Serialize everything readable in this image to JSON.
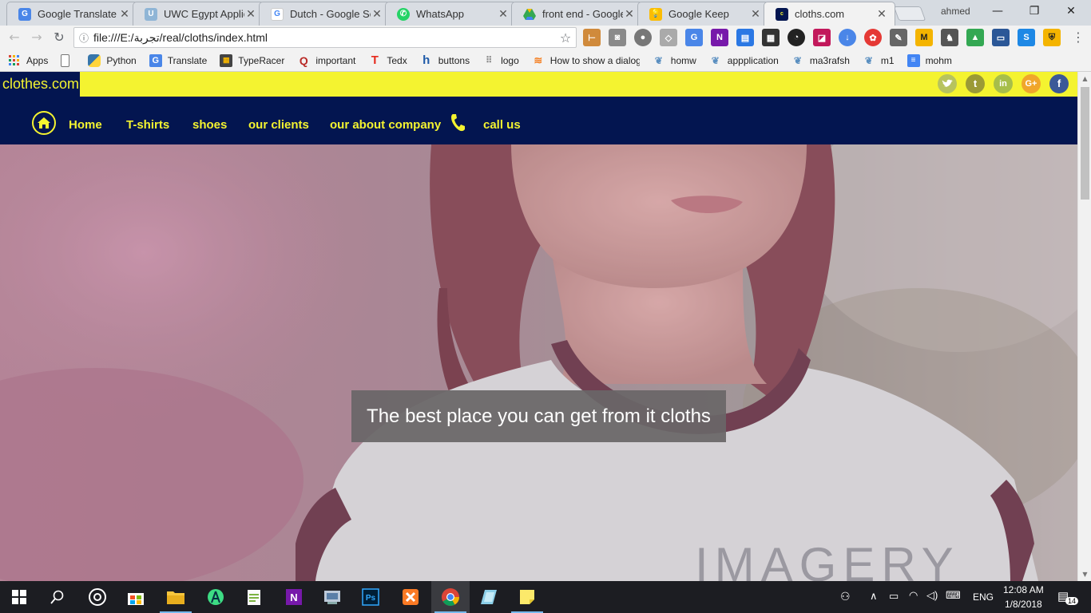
{
  "browser": {
    "tabs": [
      {
        "title": "Google Translate",
        "favicon": "translate-icon",
        "color": "#4a86e8"
      },
      {
        "title": "UWC Egypt Applic",
        "favicon": "uwc-icon",
        "color": "#8fb5d6"
      },
      {
        "title": "Dutch - Google Se",
        "favicon": "google-icon",
        "color": "#ffffff"
      },
      {
        "title": "WhatsApp",
        "favicon": "whatsapp-icon",
        "color": "#25d366"
      },
      {
        "title": "front end - Google",
        "favicon": "drive-icon",
        "color": "#fbbc04"
      },
      {
        "title": "Google Keep",
        "favicon": "keep-icon",
        "color": "#fbbc04"
      },
      {
        "title": "cloths.com",
        "favicon": "site-icon",
        "color": "#031550"
      }
    ],
    "profile_name": "ahmed",
    "url": "file:///E:/تجربة/real/cloths/index.html",
    "bookmarks": [
      {
        "label": "Apps",
        "icon": "apps-grid-icon"
      },
      {
        "label": "",
        "icon": "page-icon"
      },
      {
        "label": "Python",
        "icon": "python-icon"
      },
      {
        "label": "Translate",
        "icon": "translate-icon"
      },
      {
        "label": "TypeRacer",
        "icon": "typeracer-icon"
      },
      {
        "label": "important",
        "icon": "quora-icon"
      },
      {
        "label": "Tedx",
        "icon": "tedx-icon"
      },
      {
        "label": "buttons",
        "icon": "buttons-icon"
      },
      {
        "label": "logo",
        "icon": "logo-dots-icon"
      },
      {
        "label": "How to show a dialog",
        "icon": "stackoverflow-icon"
      },
      {
        "label": "homw",
        "icon": "uwc-icon"
      },
      {
        "label": "appplication",
        "icon": "uwc-icon"
      },
      {
        "label": "ma3rafsh",
        "icon": "uwc-icon"
      },
      {
        "label": "m1",
        "icon": "uwc-icon"
      },
      {
        "label": "mohm",
        "icon": "docs-icon"
      }
    ]
  },
  "site": {
    "logo": "clothes.com",
    "social": [
      {
        "name": "twitter-icon",
        "glyph": "t",
        "color": "#b7c35e"
      },
      {
        "name": "tumblr-icon",
        "glyph": "t",
        "color": "#9b9a36"
      },
      {
        "name": "linkedin-icon",
        "glyph": "in",
        "color": "#a7be4a"
      },
      {
        "name": "google-plus-icon",
        "glyph": "G+",
        "color": "#f0a62b"
      },
      {
        "name": "facebook-icon",
        "glyph": "f",
        "color": "#3b5998"
      }
    ],
    "nav": [
      "Home",
      "T-shirts",
      "shoes",
      "our clients",
      "our about company",
      "call us"
    ],
    "hero_caption": "The best place you can get from it cloths",
    "colors": {
      "accent": "#f4f330",
      "navy": "#031550"
    }
  },
  "taskbar": {
    "language": "ENG",
    "time": "12:08 AM",
    "date": "1/8/2018",
    "notifications": "14"
  }
}
